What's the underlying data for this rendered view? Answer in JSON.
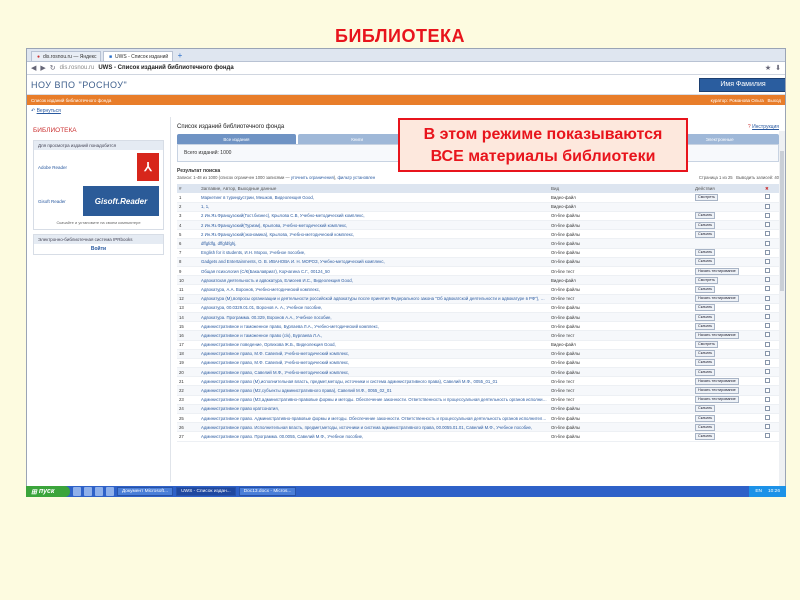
{
  "slide_title": "БИБЛИОТЕКА",
  "callout": {
    "line1": "В этом режиме показываются",
    "line2": "ВСЕ материалы библиотеки"
  },
  "browser": {
    "tabs": [
      {
        "label": "dis.rosnou.ru — Яндекс",
        "active": false
      },
      {
        "label": "UWS - Список изданий",
        "active": true
      }
    ],
    "new_tab": "+",
    "url_domain": "dis.rosnou.ru",
    "url_title": "UWS - Список изданий библиотечного фонда"
  },
  "site": {
    "org_name": "НОУ ВПО \"РОСНОУ\"",
    "user_button": "Имя Фамилия",
    "orange_left": "Список изданий библиотечного фонда",
    "orange_right": "куратор: Романова Ольга",
    "orange_exit": "Выход",
    "back_link": "Вернуться"
  },
  "left": {
    "lib_title": "БИБЛИОТЕКА",
    "box_header": "Для просмотра изданий понадобится",
    "adobe_label": "Adobe Reader",
    "gisoft_label": "Gisoft Reader",
    "gisoft_logo": "Gisoft.Reader",
    "pdf_glyph": "⅄",
    "note": "Скачайте и установите на своем компьютере",
    "ebs_header": "Электронно-библиотечная система IPRbooks",
    "enter": "Войти"
  },
  "main": {
    "title": "Список изданий библиотечного фонда",
    "instruction": "Инструкция",
    "tabs": [
      "Все издания",
      "Книги",
      "Тесты",
      "Мультимедиа",
      "Электронные"
    ],
    "total": "Всего изданий: 1000",
    "results_title": "Результат поиска",
    "results_info": "Записи: 1-48 из 1000 (список ограничен 1000 записями —",
    "refine_link": "уточнить ограничения",
    "filter_link": "фильтр установлен",
    "pager": "Страница 1 из 25",
    "per_page": "Выводить записей: 40",
    "columns": [
      "#",
      "Заглавие, Автор, Выходные данные",
      "Вид",
      "Действия",
      ""
    ],
    "rows": [
      {
        "n": "1",
        "t": "Маркетинг в туриндустрии, Мешков, Видеолекция Good,",
        "k": "Видео-файл",
        "a": "Смотреть"
      },
      {
        "n": "2",
        "t": "1, 1,",
        "k": "Видео-файл",
        "a": ""
      },
      {
        "n": "3",
        "t": "2 Ин.Яз.Французский(Гост.бизнес), Крылова С.В, Учебно-методический комплекс,",
        "k": "On-line файлы",
        "a": "Скачать"
      },
      {
        "n": "4",
        "t": "2 Ин.Яз.Французский(Туризм), Крылова, Учебно-методический комплекс,",
        "k": "On-line файлы",
        "a": "Скачать"
      },
      {
        "n": "5",
        "t": "2 Ин.Яз.Французский(экономика), Крылова, Учебно-методический комплекс,",
        "k": "On-line файлы",
        "a": "Скачать"
      },
      {
        "n": "6",
        "t": "dffgfdfg, dffgfdfghj,",
        "k": "On-line файлы",
        "a": ""
      },
      {
        "n": "7",
        "t": "English for it students, И.Н. Морох, Учебное пособие,",
        "k": "On-line файлы",
        "a": "Скачать"
      },
      {
        "n": "8",
        "t": "Gadgets and Entertainments, О. В. ИВАНОВА И. Н. МОРОЗ, Учебно-методический комплекс,",
        "k": "On-line файлы",
        "a": "Скачать"
      },
      {
        "n": "9",
        "t": "Общая психология (С/К(Бакалавриат), Корчагина С.Г., 00124_50",
        "k": "On-line тест",
        "a": "Начать тестирование"
      },
      {
        "n": "10",
        "t": "Адвокатская деятельность и адвокатура, Елисеев И.С., Видеолекция Good,",
        "k": "Видео-файл",
        "a": "Смотреть"
      },
      {
        "n": "11",
        "t": "Адвокатура, А.А. Воронов, Учебно-методический комплекс,",
        "k": "On-line файлы",
        "a": "Скачать"
      },
      {
        "n": "12",
        "t": "Адвокатура (М),вопросы организации и деятельности российской адвокатуры после принятия Федерального закона \"Об адвокатской деятельности и адвокатуре в РФ\"), РосНОУ, 0329_01_01",
        "k": "On-line тест",
        "a": "Начать тестирование"
      },
      {
        "n": "13",
        "t": "Адвокатура, 00.0329.01.01, Воронов А. А., Учебное пособие,",
        "k": "On-line файлы",
        "a": "Скачать"
      },
      {
        "n": "14",
        "t": "Адвокатура. Программа. 00.329, Воронов А.А., Учебное пособие,",
        "k": "On-line файлы",
        "a": "Скачать"
      },
      {
        "n": "15",
        "t": "Административное и таможенное право, Бурлаева Л.А., Учебно-методический комплекс,",
        "k": "On-line файлы",
        "a": "Скачать"
      },
      {
        "n": "16",
        "t": "Административное и таможенное право (с/к), Бурлаева Л.А.,",
        "k": "On-line тест",
        "a": "Начать тестирование"
      },
      {
        "n": "17",
        "t": "Административное поведение, Орлихова Ж.Б., Видеолекция Good,",
        "k": "Видео-файл",
        "a": "Смотреть"
      },
      {
        "n": "18",
        "t": "Административное право, М.Ф. Савелий, Учебно-методический комплекс,",
        "k": "On-line файлы",
        "a": "Скачать"
      },
      {
        "n": "19",
        "t": "Административное право, М.Ф. Савелий, Учебно-методический комплекс,",
        "k": "On-line файлы",
        "a": "Скачать"
      },
      {
        "n": "20",
        "t": "Административное право, Савелий М.Ф., Учебно-методический комплекс,",
        "k": "On-line файлы",
        "a": "Скачать"
      },
      {
        "n": "21",
        "t": "Административное право (М),исполнительная власть, предмет,методы, источники и система административного права), Савелий М.Ф., 0055_01_01",
        "k": "On-line тест",
        "a": "Начать тестирование"
      },
      {
        "n": "22",
        "t": "Административное право (М2,субъекты административного права), Савелий М.Ф., 0055_02_01",
        "k": "On-line тест",
        "a": "Начать тестирование"
      },
      {
        "n": "23",
        "t": "Административное право (М3,административно-правовые формы и методы. Обеспечение законности. Ответственность и процессуальная деятельность органов исполнительной власти. ), Савелий М.Ф., 0055_03_01",
        "k": "On-line тест",
        "a": "Начать тестирование"
      },
      {
        "n": "24",
        "t": "Административное право кратсонатия,",
        "k": "On-line файлы",
        "a": "Скачать"
      },
      {
        "n": "25",
        "t": "Административное право. Административно-правовые формы и методы. Обеспечение законности. Ответственность и процессуальная деятельность органов исполнительной власти, 00.0055.03.01, Савелий М.Ф., Учебное пособие,",
        "k": "On-line файлы",
        "a": "Скачать"
      },
      {
        "n": "26",
        "t": "Административное право. Исполнительная власть, предмет,методы, источники и система административного права, 00.0055.01.01, Савелий М.Ф., Учебное пособие,",
        "k": "On-line файлы",
        "a": "Скачать"
      },
      {
        "n": "27",
        "t": "Административное право. Программа. 00.0055, Савелий М.Ф., Учебное пособие,",
        "k": "On-line файлы",
        "a": "Скачать"
      }
    ]
  },
  "taskbar": {
    "start": "пуск",
    "items": [
      {
        "label": "Документ Microsoft...",
        "active": false
      },
      {
        "label": "UWS - Список издан...",
        "active": true
      },
      {
        "label": "Doc13.docx - Micros...",
        "active": false
      }
    ],
    "lang": "EN",
    "clock": "10:26"
  }
}
